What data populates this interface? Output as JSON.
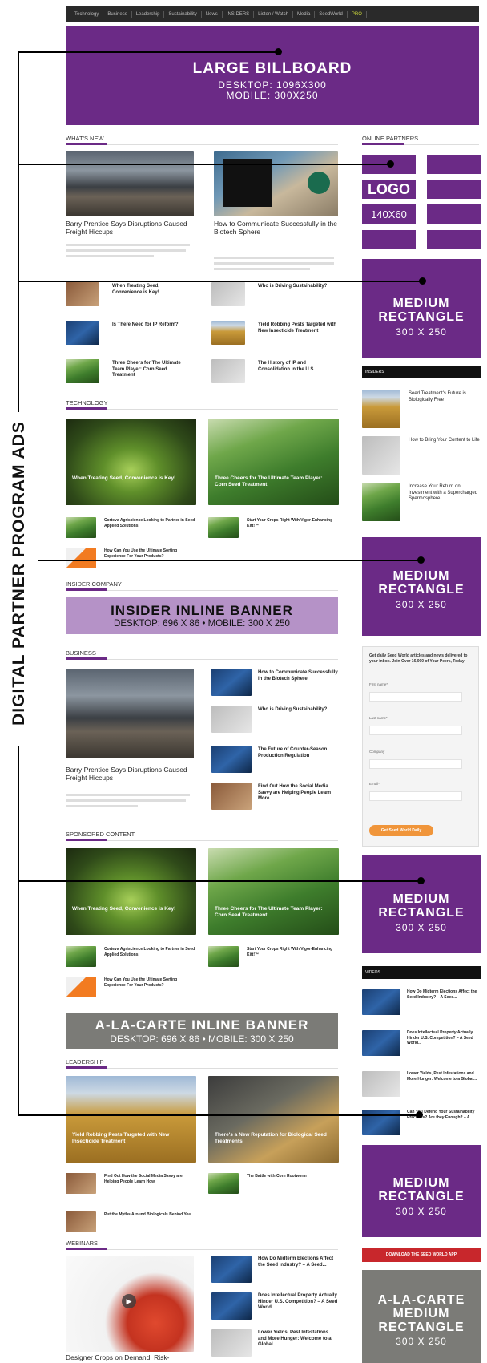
{
  "nav": {
    "items": [
      "Technology",
      "Business",
      "Leadership",
      "Sustainability",
      "News",
      "INSIDERS",
      "Listen / Watch",
      "Media",
      "SeedWorld"
    ],
    "highlight": "PRO"
  },
  "ads": {
    "billboard": {
      "title": "LARGE BILLBOARD",
      "line1": "DESKTOP: 1096X300",
      "line2": "MOBILE: 300X250"
    },
    "logo": {
      "title": "LOGO",
      "size": "140X60"
    },
    "medium_rect": {
      "line1": "MEDIUM",
      "line2": "RECTANGLE",
      "size": "300 X 250"
    },
    "insider_inline": {
      "title": "INSIDER INLINE BANNER",
      "sub": "DESKTOP: 696 X 86 • MOBILE: 300 X 250"
    },
    "alacarte_inline": {
      "title": "A-LA-CARTE INLINE BANNER",
      "sub": "DESKTOP: 696 X 86 • MOBILE: 300 X 250"
    },
    "alacarte_medium": {
      "line1": "A-LA-CARTE",
      "line2": "MEDIUM",
      "line3": "RECTANGLE",
      "size": "300 X 250"
    }
  },
  "callout": {
    "label": "DIGITAL PARTNER PROGRAM ADS"
  },
  "sections": {
    "whats_new": "WHAT'S NEW",
    "online_partners": "ONLINE PARTNERS",
    "technology": "TECHNOLOGY",
    "insider_company": "INSIDER COMPANY",
    "business": "BUSINESS",
    "sponsored": "SPONSORED CONTENT",
    "leadership": "LEADERSHIP",
    "webinars": "WEBINARS",
    "insiders": "INSIDERS",
    "videos": "VIDEOS"
  },
  "whats_new": {
    "lead1": {
      "title": "Barry Prentice Says Disruptions Caused Freight Hiccups"
    },
    "lead2": {
      "title": "How to Communicate Successfully in the Biotech Sphere"
    },
    "list": [
      "When Treating Seed, Convenience is Key!",
      "Who is Driving Sustainability?",
      "Is There Need for IP Reform?",
      "Yield Robbing Pests Targeted with New Insecticide Treatment",
      "Three Cheers for The Ultimate Team Player: Corn Seed Treatment",
      "The History of IP and Consolidation in the U.S."
    ]
  },
  "technology": {
    "card1": "When Treating Seed, Convenience is Key!",
    "card2": "Three Cheers for The Ultimate Team Player: Corn Seed Treatment",
    "list": [
      "Corteva Agriscience Looking to Partner in Seed Applied Solutions",
      "Start Your Crops Right With Vigor-Enhancing Kitt!™",
      "How Can You Use the Ultimate Sorting Experience For Your Products?"
    ]
  },
  "business": {
    "lead": "Barry Prentice Says Disruptions Caused Freight Hiccups",
    "list": [
      "How to Communicate Successfully in the Biotech Sphere",
      "Who is Driving Sustainability?",
      "The Future of Counter-Season Production Regulation",
      "Find Out How the Social Media Savvy are Helping People Learn More"
    ]
  },
  "sponsored": {
    "card1": "When Treating Seed, Convenience is Key!",
    "card2": "Three Cheers for The Ultimate Team Player: Corn Seed Treatment",
    "list": [
      "Corteva Agriscience Looking to Partner in Seed Applied Solutions",
      "Start Your Crops Right With Vigor-Enhancing Kitt!™",
      "How Can You Use the Ultimate Sorting Experience For Your Products?"
    ]
  },
  "leadership": {
    "card1": "Yield Robbing Pests Targeted with New Insecticide Treatment",
    "card2": "There's a New Reputation for Biological Seed Treatments",
    "list": [
      "Find Out How the Social Media Savvy are Helping People Learn How",
      "The Battle with Corn Rootworm",
      "Put the Myths Around Biologicals Behind You"
    ]
  },
  "webinars": {
    "lead": "Designer Crops on Demand: Risk-",
    "list": [
      "How Do Midterm Elections Affect the Seed Industry? – A Seed...",
      "Does Intellectual Property Actually Hinder U.S. Competition? – A Seed World...",
      "Lower Yields, Pest Infestations and More Hunger: Welcome to a Global..."
    ]
  },
  "insiders": {
    "list": [
      "Seed Treatment's Future is Biologically Free",
      "How to Bring Your Content to Life",
      "Increase Your Return on Investment with a Supercharged Spermosphere"
    ]
  },
  "newsletter": {
    "intro": "Get daily Seed World articles and news delivered to your inbox. Join Over 16,000 of Your Peers, Today!",
    "fields": [
      "First name*",
      "Last name*",
      "Company",
      "Email*"
    ],
    "button": "Get Seed World Daily"
  },
  "videos": {
    "list": [
      "How Do Midterm Elections Affect the Seed Industry? – A Seed...",
      "Does Intellectual Property Actually Hinder U.S. Competition? – A Seed World...",
      "Lower Yields, Pest Infestations and More Hunger: Welcome to a Global...",
      "Can You Defend Your Sustainability Practices? Are they Enough? – A..."
    ]
  },
  "app_button": "DOWNLOAD THE SEED WORLD APP"
}
